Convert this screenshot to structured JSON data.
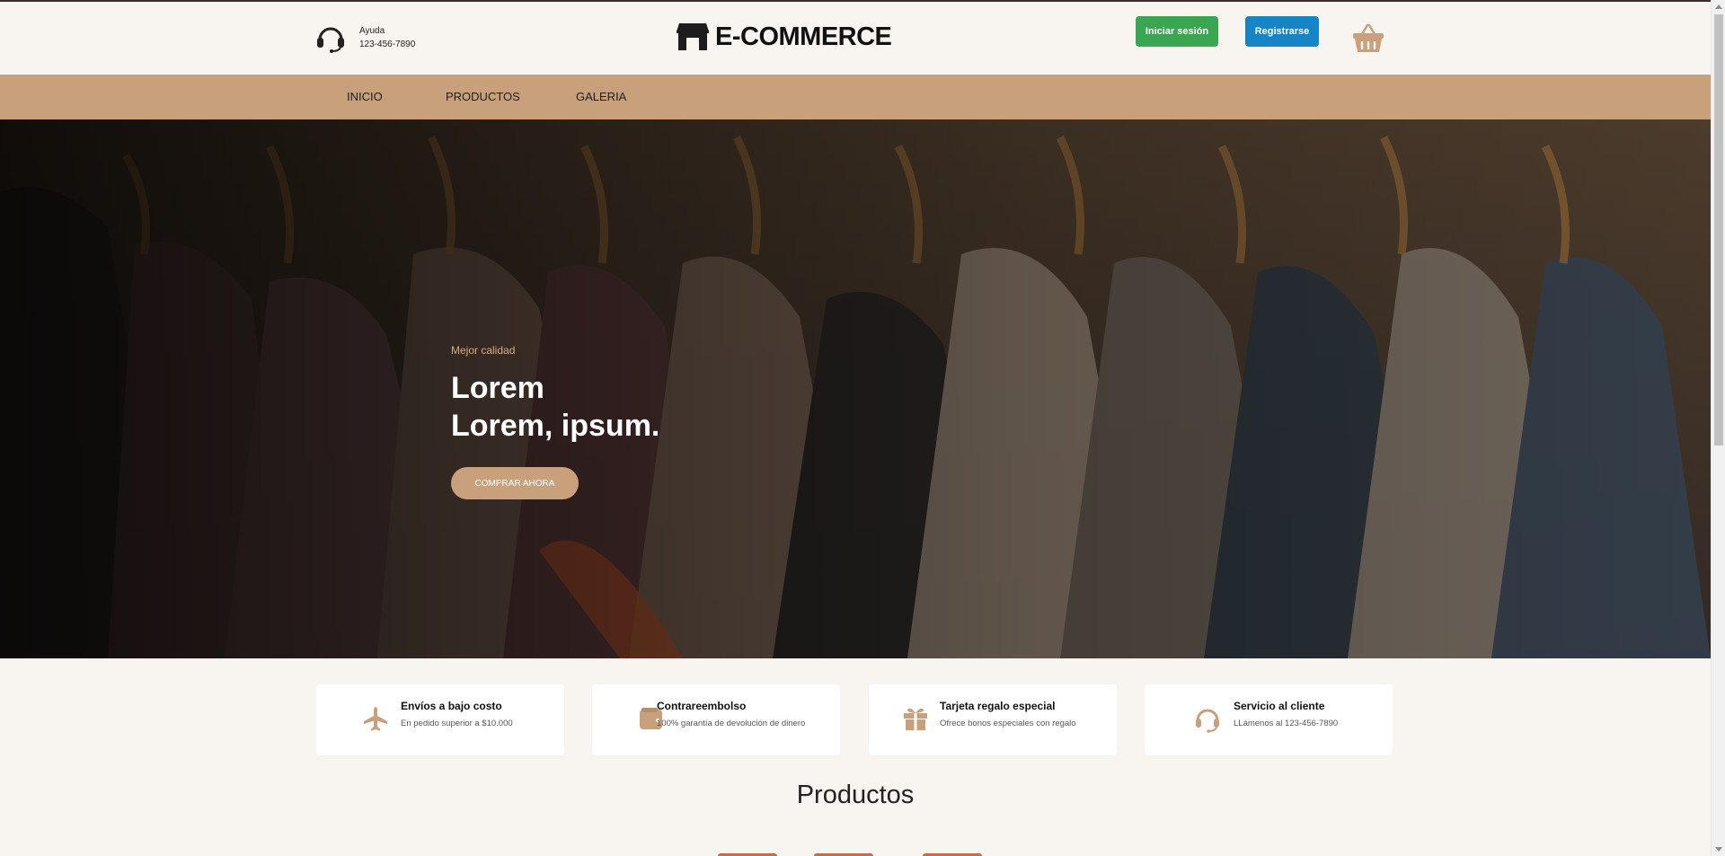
{
  "header": {
    "help_label": "Ayuda",
    "help_phone": "123-456-7890",
    "logo_text": "E-COMMERCE",
    "login_label": "Iniciar sesión",
    "register_label": "Registrarse",
    "cart_icon": "basket-icon",
    "help_icon": "headset-icon",
    "logo_icon": "store-icon"
  },
  "nav": {
    "items": [
      {
        "label": "INICIO"
      },
      {
        "label": "PRODUCTOS"
      },
      {
        "label": "GALERIA"
      }
    ]
  },
  "hero": {
    "eyebrow": "Mejor calidad",
    "title_line1": "Lorem",
    "title_line2": "Lorem, ipsum.",
    "cta_label": "COMPRAR AHORA"
  },
  "features": [
    {
      "icon": "plane-icon",
      "title": "Envíos a bajo costo",
      "subtitle": "En pedido superior a $10.000"
    },
    {
      "icon": "wallet-icon",
      "title": "Contrareembolso",
      "subtitle": "100% garantía de devolución de dinero"
    },
    {
      "icon": "gift-icon",
      "title": "Tarjeta regalo especial",
      "subtitle": "Ofrece bonos especiales con regalo"
    },
    {
      "icon": "headset-icon",
      "title": "Servicio al cliente",
      "subtitle": "LLámenos al 123-456-7890"
    }
  ],
  "products_section": {
    "title": "Productos"
  },
  "colors": {
    "accent": "#c8a07c",
    "login_button": "#3aa652",
    "register_button": "#1684c5",
    "background": "#f8f4f0"
  }
}
